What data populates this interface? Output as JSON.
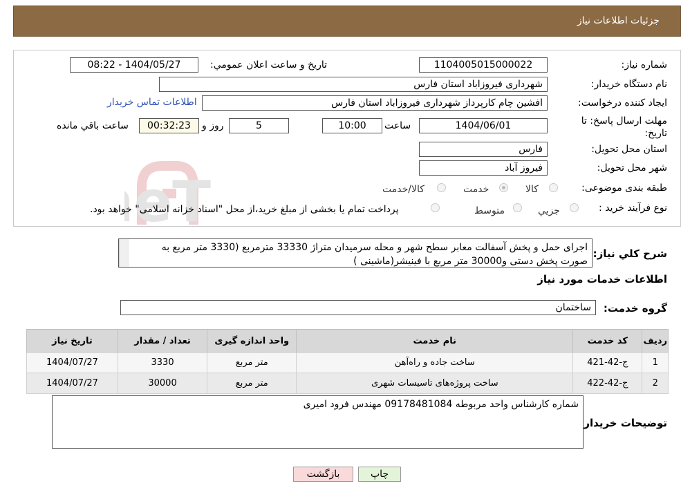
{
  "header": {
    "title": "جزئیات اطلاعات نیاز"
  },
  "form": {
    "need_number_label": "شماره نیاز:",
    "need_number": "1104005015000022",
    "announce_label": "تاریخ و ساعت اعلان عمومي:",
    "announce_value": "1404/05/27 - 08:22",
    "buyer_org_label": "نام دستگاه خريدار:",
    "buyer_org": "شهرداری فیروزاباد استان فارس",
    "creator_label": "ايجاد كننده درخواست:",
    "creator": "افشین چام کارپرداز شهرداری فیروزاباد استان فارس",
    "contact_link": "اطلاعات تماس خريدار",
    "deadline_label": "مهلت ارسال پاسخ: تا تاریخ:",
    "deadline_date": "1404/06/01",
    "hour_label": "ساعت",
    "deadline_time": "10:00",
    "days_value": "5",
    "days_label": "روز و",
    "remaining_time": "00:32:23",
    "remaining_label": "ساعت باقي مانده",
    "province_label": "استان محل تحويل:",
    "province": "فارس",
    "city_label": "شهر محل تحويل:",
    "city": "فیروز آباد",
    "category_label": "طبقه بندی موضوعی:",
    "category_options": [
      "کالا",
      "خدمت",
      "کالا/خدمت"
    ],
    "purchase_type_label": "نوع فرآيند خريد :",
    "purchase_options": [
      "جزيي",
      "متوسط"
    ],
    "purchase_note": "پرداخت تمام یا بخشی از مبلغ خرید،از محل \"اسناد خزانه اسلامی\" خواهد بود."
  },
  "summary": {
    "label": "شرح کلي نياز:",
    "text": "اجرای حمل و  پخش آسفالت معابر سطح شهر و محله سرمیدان   متراژ 33330 مترمربع (3330 متر مربع  به صورت پخش دستی و30000 متر مربع با فینیشر(ماشینی )"
  },
  "services": {
    "section_title": "اطلاعات خدمات مورد نياز",
    "group_label": "گروه خدمت:",
    "group_value": "ساختمان",
    "columns": [
      "رديف",
      "كد خدمت",
      "نام خدمت",
      "واحد اندازه گيری",
      "تعداد / مقدار",
      "تاريخ نياز"
    ],
    "rows": [
      [
        "1",
        "ج-42-421",
        "ساخت جاده و راه‌آهن",
        "متر مربع",
        "3330",
        "1404/07/27"
      ],
      [
        "2",
        "ج-42-422",
        "ساخت پروژه‌های تاسیسات شهری",
        "متر مربع",
        "30000",
        "1404/07/27"
      ]
    ]
  },
  "buyer_notes": {
    "label": "توضيحات خريدار:",
    "text": "شماره کارشناس واحد مربوطه 09178481084 مهندس فرود امیری"
  },
  "buttons": {
    "print": "چاپ",
    "back": "بازگشت"
  },
  "watermark": {
    "text": "AriaTender.neT"
  },
  "colors": {
    "header_bg": "#8c6a43",
    "link": "#2a4fb0",
    "back_btn": "#f9d9da",
    "print_btn": "#e4f4d8"
  }
}
